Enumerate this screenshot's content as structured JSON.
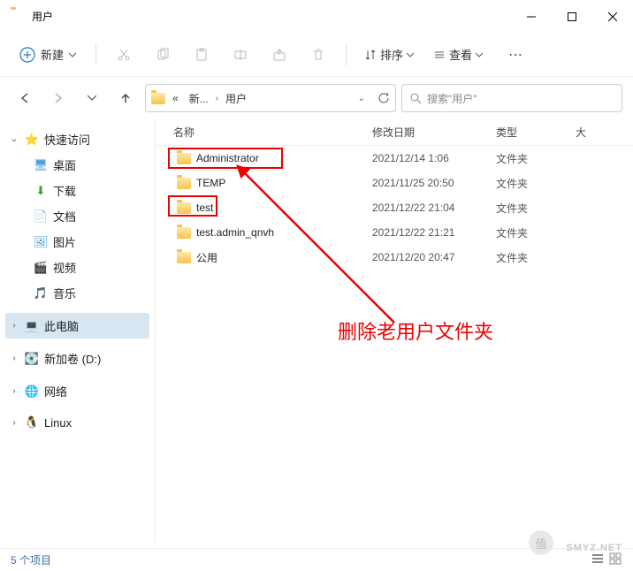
{
  "window": {
    "title": "用户"
  },
  "toolbar": {
    "new_label": "新建",
    "sort_label": "排序",
    "view_label": "查看"
  },
  "breadcrumb": {
    "root": "新...",
    "current": "用户"
  },
  "search": {
    "placeholder": "搜索\"用户\""
  },
  "sidebar": {
    "quick_access": "快速访问",
    "desktop": "桌面",
    "downloads": "下载",
    "documents": "文档",
    "pictures": "图片",
    "videos": "视频",
    "music": "音乐",
    "this_pc": "此电脑",
    "new_volume": "新加卷 (D:)",
    "network": "网络",
    "linux": "Linux"
  },
  "columns": {
    "name": "名称",
    "date": "修改日期",
    "type": "类型",
    "size": "大"
  },
  "files": [
    {
      "name": "Administrator",
      "date": "2021/12/14 1:06",
      "type": "文件夹"
    },
    {
      "name": "TEMP",
      "date": "2021/11/25 20:50",
      "type": "文件夹"
    },
    {
      "name": "test",
      "date": "2021/12/22 21:04",
      "type": "文件夹"
    },
    {
      "name": "test.admin_qnvh",
      "date": "2021/12/22 21:21",
      "type": "文件夹"
    },
    {
      "name": "公用",
      "date": "2021/12/20 20:47",
      "type": "文件夹"
    }
  ],
  "annotation": "删除老用户文件夹",
  "status": {
    "count": "5 个项目"
  },
  "watermark": {
    "text": "SMYZ.NET",
    "badge": "值"
  }
}
